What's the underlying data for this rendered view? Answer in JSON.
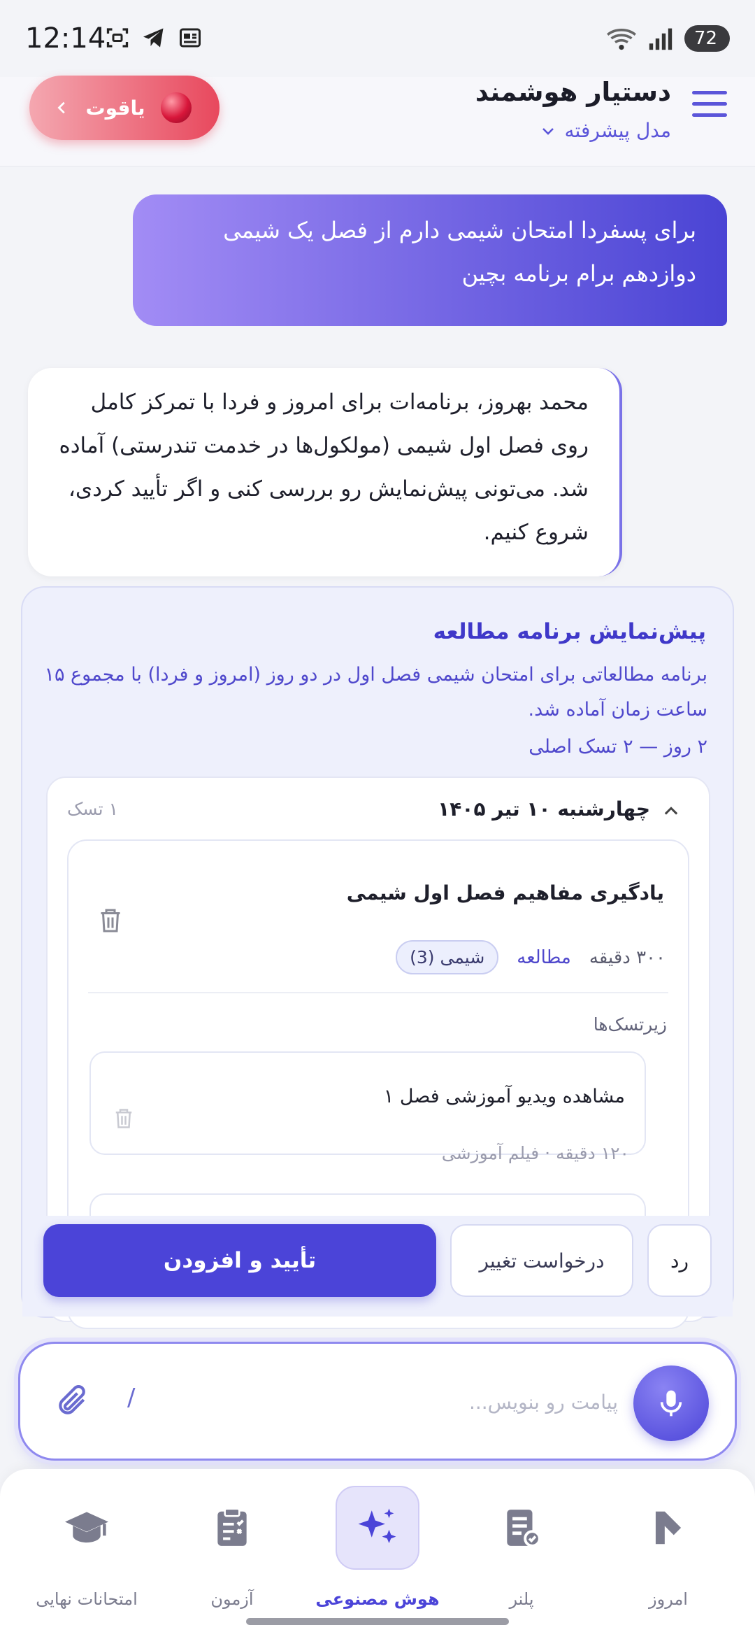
{
  "status_bar": {
    "time": "12:14",
    "battery": "72"
  },
  "header": {
    "title": "دستیار هوشمند",
    "model": "مدل پیشرفته",
    "ruby_label": "یاقوت"
  },
  "chat": {
    "user_message": "برای پسفردا امتحان شیمی دارم از فصل یک شیمی دوازدهم برام برنامه بچین",
    "ai_message": "محمد بهروز، برنامه‌ات برای امروز و فردا با تمرکز کامل روی فصل اول شیمی (مولکول‌ها در خدمت تندرستی) آماده شد. می‌تونی پیش‌نمایش رو بررسی کنی و اگر تأیید کردی، شروع کنیم."
  },
  "plan": {
    "title": "پیش‌نمایش برنامه مطالعه",
    "description": "برنامه مطالعاتی برای امتحان شیمی فصل اول در دو روز (امروز و فردا) با مجموع ۱۵ ساعت زمان آماده شد.",
    "meta": "۲ روز — ۲ تسک اصلی",
    "day": {
      "title": "چهارشنبه ۱۰ تیر ۱۴۰۵",
      "count": "۱ تسک",
      "task": {
        "title": "یادگیری مفاهیم فصل اول شیمی",
        "duration": "۳۰۰ دقیقه",
        "type": "مطالعه",
        "subject_chip": "شیمی (3)",
        "subtasks_label": "زیرتسک‌ها",
        "subtasks": [
          {
            "title": "مشاهده ویدیو آموزشی فصل ۱",
            "meta": "۱۲۰ دقیقه · فیلم آموزشی"
          }
        ]
      }
    },
    "buttons": {
      "confirm": "تأیید و افزودن",
      "change": "درخواست تغییر",
      "reject": "رد"
    }
  },
  "input": {
    "placeholder": "پیامت رو بنویس...",
    "slash": "/"
  },
  "nav": [
    {
      "label": "امروز",
      "icon": "today-icon"
    },
    {
      "label": "پلنر",
      "icon": "planner-icon"
    },
    {
      "label": "هوش مصنوعی",
      "icon": "ai-sparkle-icon",
      "active": true
    },
    {
      "label": "آزمون",
      "icon": "exam-icon"
    },
    {
      "label": "امتحانات نهایی",
      "icon": "graduation-cap-icon"
    }
  ],
  "colors": {
    "accent": "#4b44d8",
    "ruby": "#e8485d",
    "card_bg": "#eef0fc"
  }
}
